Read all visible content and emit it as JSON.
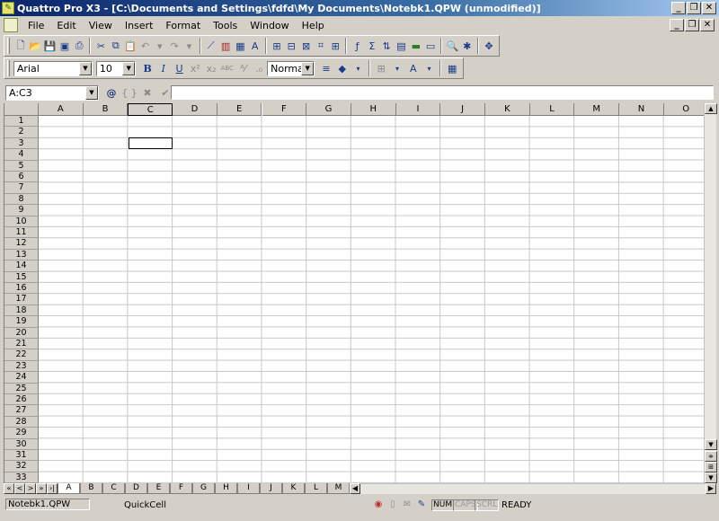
{
  "window": {
    "title": "Quattro Pro X3 - [C:\\Documents and Settings\\fdfd\\My Documents\\Notebk1.QPW (unmodified)]",
    "app_icon": "quattro-app-icon",
    "controls": [
      "_",
      "□",
      "x"
    ]
  },
  "menubar": {
    "items": [
      "File",
      "Edit",
      "View",
      "Insert",
      "Format",
      "Tools",
      "Window",
      "Help"
    ]
  },
  "toolbar2": {
    "font": "Arial",
    "size": "10",
    "style": "Normal"
  },
  "input_line": {
    "cell_ref": "A:C3",
    "at_symbol": "@",
    "braces": "{ }",
    "cancel": "✖",
    "confirm": "✔",
    "formula": ""
  },
  "sheet": {
    "columns": [
      "A",
      "B",
      "C",
      "D",
      "E",
      "F",
      "G",
      "H",
      "I",
      "J",
      "K",
      "L",
      "M",
      "N",
      "O"
    ],
    "rows": [
      "1",
      "2",
      "3",
      "4",
      "5",
      "6",
      "7",
      "8",
      "9",
      "10",
      "11",
      "12",
      "13",
      "14",
      "15",
      "16",
      "17",
      "18",
      "19",
      "20",
      "21",
      "22",
      "23",
      "24",
      "25",
      "26",
      "27",
      "28",
      "29",
      "30",
      "31",
      "32",
      "33"
    ],
    "active_cell": "C3"
  },
  "tabs": {
    "nav": [
      "«",
      "<",
      ">",
      "»",
      "›|"
    ],
    "sheets": [
      "A",
      "B",
      "C",
      "D",
      "E",
      "F",
      "G",
      "H",
      "I",
      "J",
      "K",
      "L",
      "M"
    ],
    "active": "A"
  },
  "statusbar": {
    "file": "Notebk1.QPW",
    "quickcell": "QuickCell",
    "indicators": {
      "num": "NUM",
      "caps": "CAPS",
      "scrl": "SCRL"
    },
    "mode": "READY"
  }
}
